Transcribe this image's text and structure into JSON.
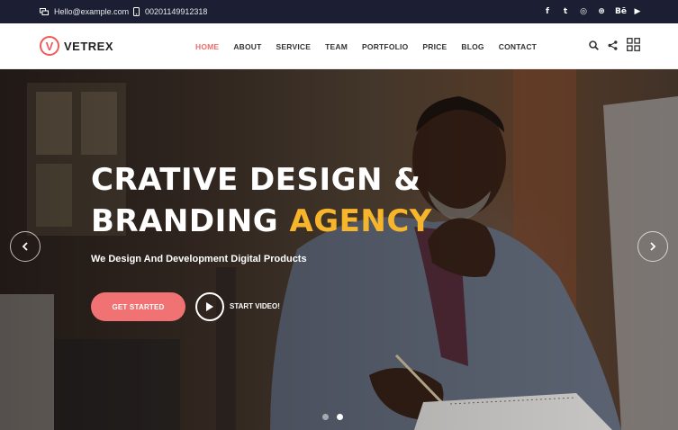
{
  "topbar": {
    "email": "Hello@example.com",
    "phone": "00201149912318",
    "socials": [
      {
        "icon": "facebook-icon",
        "glyph": "f"
      },
      {
        "icon": "twitter-icon",
        "glyph": "t"
      },
      {
        "icon": "instagram-icon",
        "glyph": "◎"
      },
      {
        "icon": "dribbble-icon",
        "glyph": "⊛"
      },
      {
        "icon": "behance-icon",
        "glyph": "Bē"
      },
      {
        "icon": "youtube-icon",
        "glyph": "▶"
      }
    ]
  },
  "brand": {
    "mark": "V",
    "name": "VETREX",
    "accent_color": "#f05a5a"
  },
  "nav": {
    "items": [
      "HOME",
      "ABOUT",
      "SERVICE",
      "TEAM",
      "PORTFOLIO",
      "PRICE",
      "BLOG",
      "CONTACT"
    ],
    "active": "HOME"
  },
  "hero": {
    "title_line1": "CRATIVE DESIGN &",
    "title_line2_plain": "BRANDING ",
    "title_line2_accent": "AGENCY",
    "subtitle": "We Design And Development Digital Products",
    "cta_label": "GET STARTED",
    "video_label": "START VIDEO!",
    "accent_color": "#f7b52c",
    "cta_color": "#f07272",
    "slide_count": 2,
    "active_slide": 2
  }
}
